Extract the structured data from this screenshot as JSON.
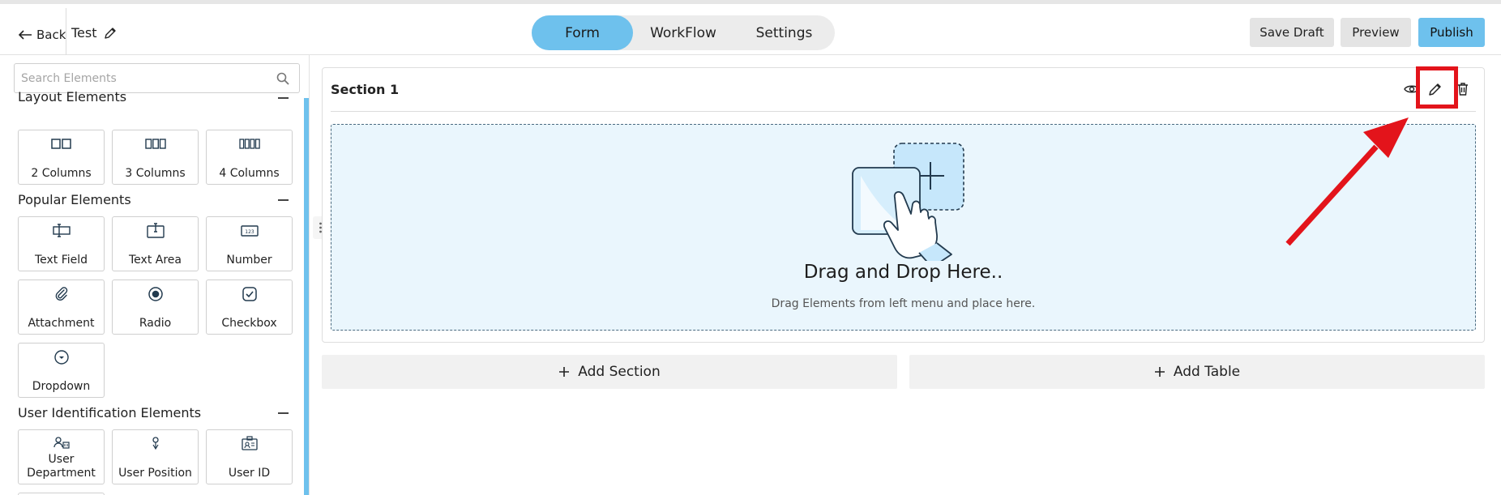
{
  "header": {
    "back_label": "Back",
    "form_name": "Test",
    "tabs": [
      {
        "label": "Form",
        "active": true
      },
      {
        "label": "WorkFlow",
        "active": false
      },
      {
        "label": "Settings",
        "active": false
      }
    ],
    "save_draft_label": "Save Draft",
    "preview_label": "Preview",
    "publish_label": "Publish"
  },
  "sidebar": {
    "search_placeholder": "Search Elements",
    "groups": [
      {
        "title": "Layout Elements",
        "items": [
          {
            "label": "2 Columns",
            "icon": "two-columns-icon"
          },
          {
            "label": "3 Columns",
            "icon": "three-columns-icon"
          },
          {
            "label": "4 Columns",
            "icon": "four-columns-icon"
          }
        ]
      },
      {
        "title": "Popular Elements",
        "items": [
          {
            "label": "Text Field",
            "icon": "text-field-icon"
          },
          {
            "label": "Text Area",
            "icon": "text-area-icon"
          },
          {
            "label": "Number",
            "icon": "number-icon"
          },
          {
            "label": "Attachment",
            "icon": "paperclip-icon"
          },
          {
            "label": "Radio",
            "icon": "radio-icon"
          },
          {
            "label": "Checkbox",
            "icon": "checkbox-icon"
          },
          {
            "label": "Dropdown",
            "icon": "dropdown-icon"
          }
        ]
      },
      {
        "title": "User Identification Elements",
        "items": [
          {
            "label": "User Department",
            "icon": "user-department-icon"
          },
          {
            "label": "User Position",
            "icon": "user-position-icon"
          },
          {
            "label": "User ID",
            "icon": "user-id-icon"
          }
        ]
      }
    ]
  },
  "section": {
    "title": "Section 1",
    "dropzone_title": "Drag and Drop Here..",
    "dropzone_subtitle": "Drag Elements from left menu and place here."
  },
  "actions": {
    "add_section_label": "Add Section",
    "add_table_label": "Add Table"
  },
  "colors": {
    "accent": "#6ec1ed",
    "highlight": "#e3141b",
    "dropzone_bg": "#eaf6fd"
  }
}
